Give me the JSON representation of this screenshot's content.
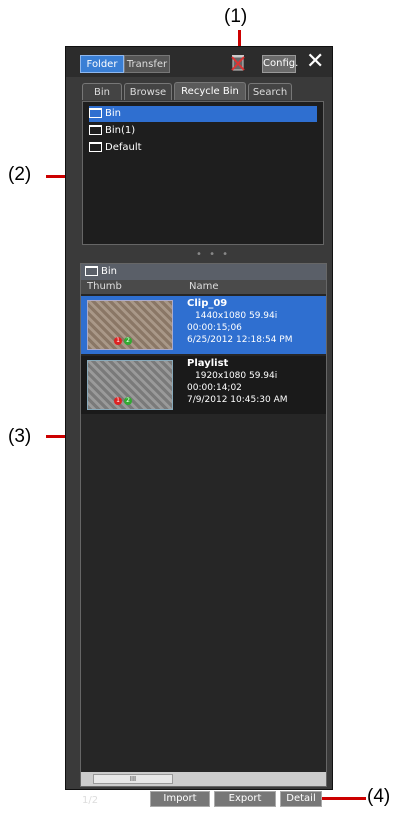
{
  "callouts": [
    "(1)",
    "(2)",
    "(3)",
    "(4)"
  ],
  "topbar": {
    "folder_label": "Folder",
    "transfer_label": "Transfer",
    "config_label": "Config."
  },
  "tabs": [
    "Bin",
    "Browse",
    "Recycle Bin",
    "Search"
  ],
  "tree": {
    "items": [
      "Bin",
      "Bin(1)",
      "Default"
    ]
  },
  "list": {
    "header_title": "Bin",
    "columns": [
      "Thumb",
      "Name"
    ],
    "rows": [
      {
        "name": "Clip_09",
        "format": "1440x1080 59.94i",
        "duration": "00:00:15;06",
        "date": "6/25/2012 12:18:54 PM"
      },
      {
        "name": "Playlist",
        "format": "1920x1080 59.94i",
        "duration": "00:00:14;02",
        "date": "7/9/2012 10:45:30 AM"
      }
    ],
    "scroll_thumb": "III"
  },
  "footer": {
    "page": "1/2",
    "import_label": "Import",
    "export_label": "Export",
    "detail_label": "Detail"
  },
  "colors": {
    "selected": "#2f6fd0",
    "panel": "#3a3a3a",
    "callout_line": "#cc0000"
  }
}
